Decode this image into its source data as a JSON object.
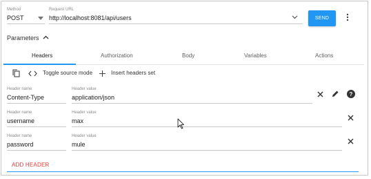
{
  "request": {
    "method_label": "Method",
    "method_value": "POST",
    "url_label": "Request URL",
    "url_value": "http://localhost:8081/api/users",
    "send_label": "SEND"
  },
  "parameters": {
    "title": "Parameters"
  },
  "tabs": [
    {
      "label": "Headers",
      "active": true
    },
    {
      "label": "Authorization",
      "active": false
    },
    {
      "label": "Body",
      "active": false
    },
    {
      "label": "Variables",
      "active": false
    },
    {
      "label": "Actions",
      "active": false
    }
  ],
  "toolbar": {
    "toggle_label": "Toggle source mode",
    "insert_label": "Insert headers set"
  },
  "headers": [
    {
      "name_label": "Header name",
      "name": "Content-Type",
      "value_label": "Header value",
      "value": "application/json"
    },
    {
      "name_label": "Header name",
      "name": "username",
      "value_label": "Header value",
      "value": "max"
    },
    {
      "name_label": "Header name",
      "name": "password",
      "value_label": "Header value",
      "value": "mule"
    }
  ],
  "add_header_label": "ADD HEADER",
  "colors": {
    "accent": "#2196f3",
    "danger": "#e53935"
  },
  "icons": [
    "dropdown-arrow-icon",
    "chevron-down-icon",
    "more-vert-icon",
    "chevron-up-icon",
    "copy-icon",
    "code-icon",
    "plus-icon",
    "close-icon",
    "edit-icon",
    "help-icon",
    "cursor-icon"
  ]
}
